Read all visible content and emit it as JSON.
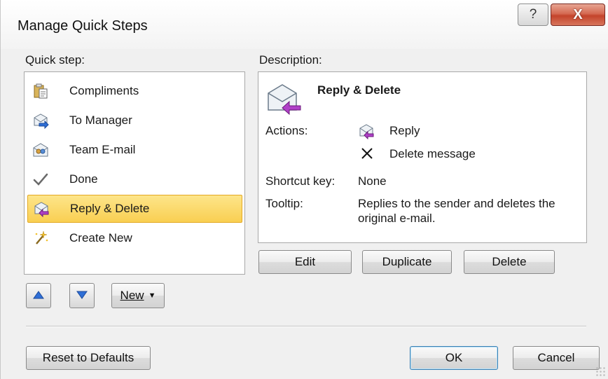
{
  "window": {
    "title": "Manage Quick Steps",
    "help_glyph": "?",
    "close_glyph": "X"
  },
  "quick_step": {
    "label": "Quick step:",
    "items": [
      {
        "label": "Compliments",
        "icon": "clipboard-paste-icon"
      },
      {
        "label": "To Manager",
        "icon": "forward-mail-icon"
      },
      {
        "label": "Team E-mail",
        "icon": "team-mail-icon"
      },
      {
        "label": "Done",
        "icon": "checkmark-icon"
      },
      {
        "label": "Reply & Delete",
        "icon": "reply-delete-icon",
        "selected": true
      },
      {
        "label": "Create New",
        "icon": "sparkle-wand-icon"
      }
    ]
  },
  "description": {
    "label": "Description:",
    "name": "Reply & Delete",
    "actions_label": "Actions:",
    "actions": [
      {
        "label": "Reply",
        "icon": "reply-mail-icon"
      },
      {
        "label": "Delete message",
        "icon": "delete-x-icon"
      }
    ],
    "shortcut_label": "Shortcut key:",
    "shortcut_value": "None",
    "tooltip_label": "Tooltip:",
    "tooltip_line1": "Replies to the sender and deletes the",
    "tooltip_line2": "original e-mail."
  },
  "buttons": {
    "edit": "Edit",
    "duplicate": "Duplicate",
    "delete": "Delete",
    "new": "New",
    "reset": "Reset to Defaults",
    "ok": "OK",
    "cancel": "Cancel"
  },
  "colors": {
    "selection": "#f9cf52",
    "selection_border": "#e3a823",
    "close_button": "#c3432b",
    "arrow_blue": "#2f6fd6"
  }
}
